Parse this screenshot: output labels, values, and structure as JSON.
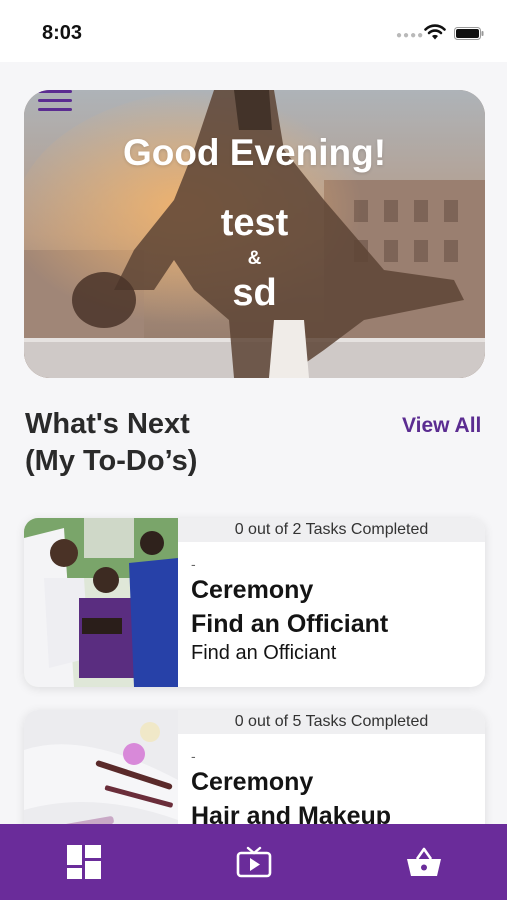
{
  "status_bar": {
    "time": "8:03"
  },
  "header": {
    "menu_icon": "hamburger-menu-icon"
  },
  "hero": {
    "greeting": "Good Evening!",
    "partner_one": "test",
    "ampersand": "&",
    "partner_two": "sd"
  },
  "section": {
    "title_line1": "What's Next",
    "title_line2": "(My To-Do’s)",
    "view_all_label": "View All"
  },
  "todos": [
    {
      "progress": "0 out of 2 Tasks Completed",
      "dash": "-",
      "category": "Ceremony",
      "title": "Find an Officiant",
      "subtitle": "Find an Officiant",
      "image": "wedding-officiant-photo"
    },
    {
      "progress": "0 out of 5 Tasks Completed",
      "dash": "-",
      "category": "Ceremony",
      "title": "Hair and Makeup",
      "subtitle": "",
      "image": "makeup-supplies-photo"
    }
  ],
  "tab_bar": {
    "tabs": [
      "dashboard-icon",
      "video-icon",
      "shopping-basket-icon"
    ]
  },
  "colors": {
    "accent": "#5b2c91",
    "tab_bar": "#6a2c9a",
    "card_progress_bg": "#efeff1"
  }
}
